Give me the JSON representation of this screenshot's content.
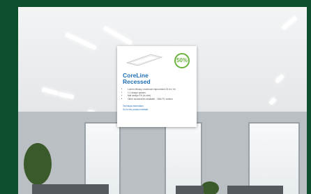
{
  "card": {
    "title_line1": "CoreLine",
    "title_line2": "Recessed",
    "badge_value": "50%",
    "badge_caption": "",
    "bullets": [
      "Lumen effcacy: maximum improvment 15 lm / lm",
      "1:1 design options",
      "Mat design 3% (to size)",
      "Other accessories available - 160k PL version"
    ],
    "links": [
      "Technical information",
      "Go to the product website"
    ]
  },
  "colors": {
    "frame": "#0d4f2c",
    "accent": "#1f6fb5",
    "badge": "#6bb33f"
  }
}
